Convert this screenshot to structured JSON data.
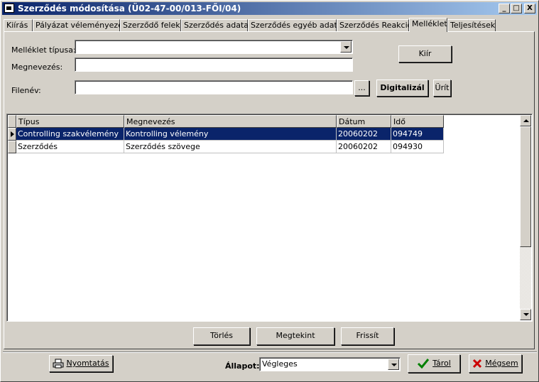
{
  "window": {
    "title": "Szerződés módosítása (Ü02-47-00/013-FŐI/04)",
    "min": "_",
    "max": "□",
    "close": "X"
  },
  "tabs": [
    {
      "label": "Kiírás"
    },
    {
      "label": "Pályázat véleményezés"
    },
    {
      "label": "Szerződő felek"
    },
    {
      "label": "Szerződés adatai"
    },
    {
      "label": "Szerződés egyéb adatai"
    },
    {
      "label": "Szerződés Reakció"
    },
    {
      "label": "Melléklet"
    },
    {
      "label": "Teljesítések"
    }
  ],
  "form": {
    "type_label": "Melléklet típusa:",
    "type_value": "",
    "name_label": "Megnevezés:",
    "name_value": "",
    "file_label": "Filenév:",
    "file_value": "",
    "browse_label": "...",
    "digitize_label": "Digitalizál",
    "clear_label": "Ürít",
    "write_label": "Kiír"
  },
  "grid": {
    "columns": [
      "Típus",
      "Megnevezés",
      "Dátum",
      "Idő"
    ],
    "rows": [
      {
        "type": "Controlling szakvélemény",
        "name": "Kontrolling vélemény",
        "date": "20060202",
        "time": "094749"
      },
      {
        "type": "Szerződés",
        "name": "Szerződés szövege",
        "date": "20060202",
        "time": "094930"
      }
    ]
  },
  "actions": {
    "delete": "Törlés",
    "view": "Megtekint",
    "refresh": "Frissít"
  },
  "footer": {
    "print": "Nyomtatás",
    "status_label": "Állapot:",
    "status_value": "Végleges",
    "save": "Tárol",
    "cancel": "Mégsem"
  },
  "colors": {
    "title_start": "#0a246a",
    "title_end": "#a6caf0",
    "selection": "#0a246a",
    "save_check": "#008000",
    "cancel_x": "#cc0000"
  }
}
